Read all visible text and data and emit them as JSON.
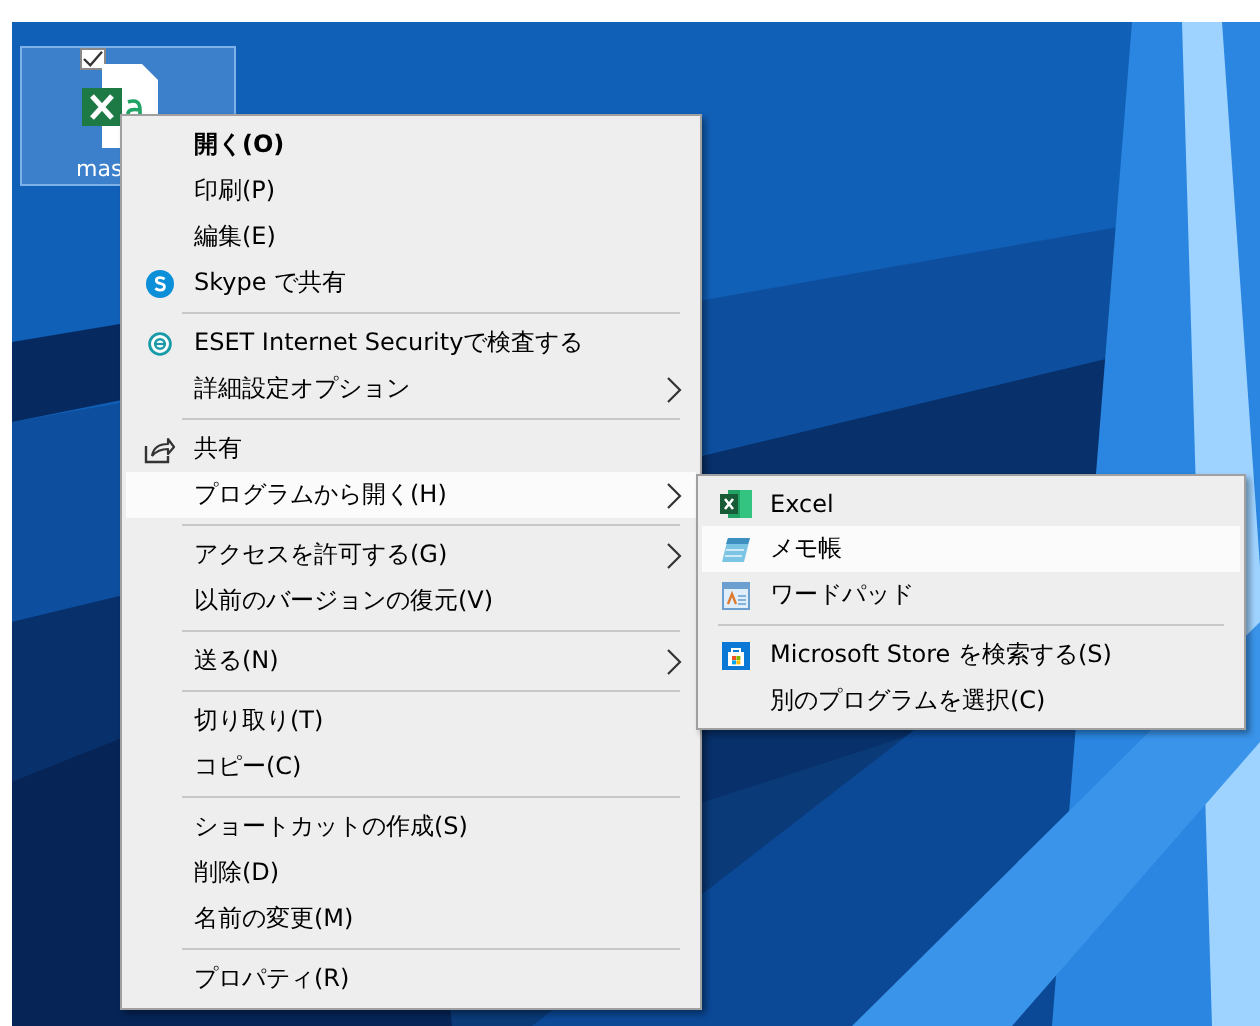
{
  "desktop_icon": {
    "label": "mas",
    "selected": true,
    "checked": true
  },
  "context_menu": {
    "items": [
      {
        "kind": "item",
        "label": "開く(O)",
        "default": true,
        "selected": false,
        "submenu": false
      },
      {
        "kind": "item",
        "label": "印刷(P)",
        "default": false,
        "selected": false,
        "submenu": false
      },
      {
        "kind": "item",
        "label": "編集(E)",
        "default": false,
        "selected": false,
        "submenu": false
      },
      {
        "kind": "item",
        "label": "Skype で共有",
        "default": false,
        "selected": false,
        "submenu": false
      },
      {
        "kind": "separator"
      },
      {
        "kind": "item",
        "label": "ESET Internet Securityで検査する",
        "default": false,
        "selected": false,
        "submenu": false
      },
      {
        "kind": "item",
        "label": "詳細設定オプション",
        "default": false,
        "selected": false,
        "submenu": true
      },
      {
        "kind": "separator"
      },
      {
        "kind": "item",
        "label": "共有",
        "default": false,
        "selected": false,
        "submenu": false
      },
      {
        "kind": "item",
        "label": "プログラムから開く(H)",
        "default": false,
        "selected": true,
        "submenu": true
      },
      {
        "kind": "separator"
      },
      {
        "kind": "item",
        "label": "アクセスを許可する(G)",
        "default": false,
        "selected": false,
        "submenu": true
      },
      {
        "kind": "item",
        "label": "以前のバージョンの復元(V)",
        "default": false,
        "selected": false,
        "submenu": false
      },
      {
        "kind": "separator"
      },
      {
        "kind": "item",
        "label": "送る(N)",
        "default": false,
        "selected": false,
        "submenu": true
      },
      {
        "kind": "separator"
      },
      {
        "kind": "item",
        "label": "切り取り(T)",
        "default": false,
        "selected": false,
        "submenu": false
      },
      {
        "kind": "item",
        "label": "コピー(C)",
        "default": false,
        "selected": false,
        "submenu": false
      },
      {
        "kind": "separator"
      },
      {
        "kind": "item",
        "label": "ショートカットの作成(S)",
        "default": false,
        "selected": false,
        "submenu": false
      },
      {
        "kind": "item",
        "label": "削除(D)",
        "default": false,
        "selected": false,
        "submenu": false
      },
      {
        "kind": "item",
        "label": "名前の変更(M)",
        "default": false,
        "selected": false,
        "submenu": false
      },
      {
        "kind": "separator"
      },
      {
        "kind": "item",
        "label": "プロパティ(R)",
        "default": false,
        "selected": false,
        "submenu": false
      }
    ]
  },
  "open_with_submenu": {
    "items": [
      {
        "kind": "item",
        "label": "Excel",
        "selected": false
      },
      {
        "kind": "item",
        "label": "メモ帳",
        "selected": true
      },
      {
        "kind": "item",
        "label": "ワードパッド",
        "selected": false
      },
      {
        "kind": "separator"
      },
      {
        "kind": "item",
        "label": "Microsoft Store を検索する(S)",
        "selected": false
      },
      {
        "kind": "item",
        "label": "別のプログラムを選択(C)",
        "selected": false
      }
    ]
  }
}
